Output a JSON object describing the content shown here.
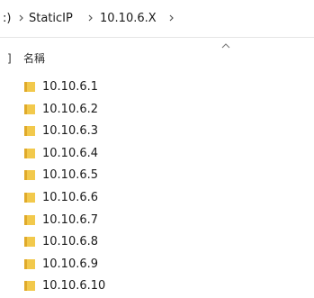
{
  "breadcrumb": {
    "items": [
      ":)",
      "StaticIP",
      "10.10.6.X"
    ]
  },
  "header": {
    "edge": "]",
    "name_column": "名稱",
    "sort_icon": "chevron-up-icon"
  },
  "files": [
    {
      "name": "10.10.6.1"
    },
    {
      "name": "10.10.6.2"
    },
    {
      "name": "10.10.6.3"
    },
    {
      "name": "10.10.6.4"
    },
    {
      "name": "10.10.6.5"
    },
    {
      "name": "10.10.6.6"
    },
    {
      "name": "10.10.6.7"
    },
    {
      "name": "10.10.6.8"
    },
    {
      "name": "10.10.6.9"
    },
    {
      "name": "10.10.6.10"
    }
  ],
  "colors": {
    "folder": "#f2c94c",
    "folder_dark": "#e0aa2a",
    "text": "#1a1a1a"
  }
}
